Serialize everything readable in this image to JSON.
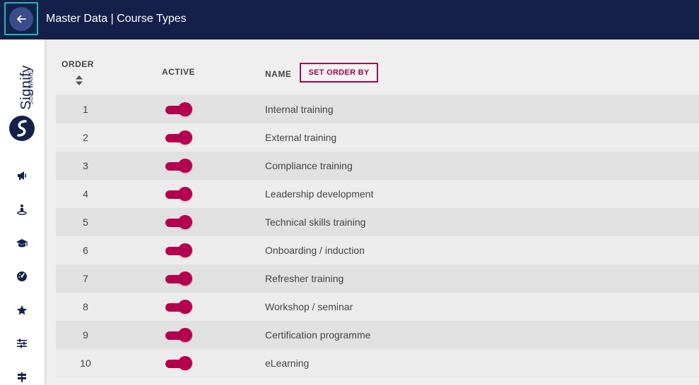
{
  "header": {
    "title": "Master Data | Course Types",
    "back_icon": "arrow-left-icon"
  },
  "brand": {
    "logo_word": "Signify",
    "logo_sub": "SOFTWARE",
    "colors": {
      "navy": "#13214a",
      "accent": "#b5004f",
      "focus": "#27b7b9"
    }
  },
  "sidebar": {
    "icons": [
      "megaphone-icon",
      "person-pin-icon",
      "graduation-cap-icon",
      "dashboard-gauge-icon",
      "star-icon",
      "sliders-icon",
      "signpost-icon"
    ]
  },
  "table": {
    "columns": {
      "order": "ORDER",
      "active": "ACTIVE",
      "name": "NAME"
    },
    "set_order_label": "SET ORDER BY",
    "rows": [
      {
        "order": "1",
        "active": true,
        "name": "Internal training"
      },
      {
        "order": "2",
        "active": true,
        "name": "External training"
      },
      {
        "order": "3",
        "active": true,
        "name": "Compliance training"
      },
      {
        "order": "4",
        "active": true,
        "name": "Leadership development"
      },
      {
        "order": "5",
        "active": true,
        "name": "Technical skills training"
      },
      {
        "order": "6",
        "active": true,
        "name": "Onboarding / induction"
      },
      {
        "order": "7",
        "active": true,
        "name": "Refresher training"
      },
      {
        "order": "8",
        "active": true,
        "name": "Workshop / seminar"
      },
      {
        "order": "9",
        "active": true,
        "name": "Certification programme"
      },
      {
        "order": "10",
        "active": true,
        "name": "eLearning"
      }
    ]
  }
}
